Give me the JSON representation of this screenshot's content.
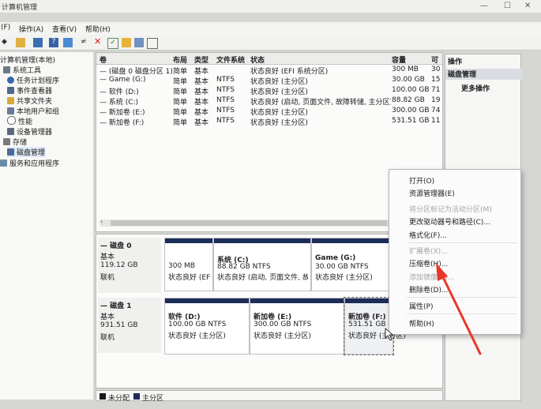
{
  "window": {
    "title": "计算机管理"
  },
  "menu": [
    "(F)",
    "操作(A)",
    "查看(V)",
    "帮助(H)"
  ],
  "tree": [
    {
      "label": "计算机管理(本地)"
    },
    {
      "label": "系统工具"
    },
    {
      "label": "任务计划程序"
    },
    {
      "label": "事件查看器"
    },
    {
      "label": "共享文件夹"
    },
    {
      "label": "本地用户和组"
    },
    {
      "label": "性能"
    },
    {
      "label": "设备管理器"
    },
    {
      "label": "存储"
    },
    {
      "label": "磁盘管理"
    },
    {
      "label": "服务和应用程序"
    }
  ],
  "volume_table": {
    "headers": [
      "卷",
      "布局",
      "类型",
      "文件系统",
      "状态",
      "容量",
      "可"
    ],
    "rows": [
      [
        "— (磁盘 0 磁盘分区 1)",
        "简单",
        "基本",
        "",
        "状态良好 (EFI 系统分区)",
        "300 MB",
        "30"
      ],
      [
        "— Game (G:)",
        "简单",
        "基本",
        "NTFS",
        "状态良好 (主分区)",
        "30.00 GB",
        "15"
      ],
      [
        "— 软件 (D:)",
        "简单",
        "基本",
        "NTFS",
        "状态良好 (主分区)",
        "100.00 GB",
        "71"
      ],
      [
        "— 系统 (C:)",
        "简单",
        "基本",
        "NTFS",
        "状态良好 (启动, 页面文件, 故障转储, 主分区)",
        "88.82 GB",
        "19"
      ],
      [
        "— 新加卷 (E:)",
        "简单",
        "基本",
        "NTFS",
        "状态良好 (主分区)",
        "300.00 GB",
        "74"
      ],
      [
        "— 新加卷 (F:)",
        "简单",
        "基本",
        "NTFS",
        "状态良好 (主分区)",
        "531.51 GB",
        "11"
      ]
    ]
  },
  "disks": [
    {
      "name": "— 磁盘 0",
      "type": "基本",
      "size": "119.12 GB",
      "status": "联机",
      "partitions": [
        {
          "name": "",
          "size": "300 MB",
          "status": "状态良好 (EF"
        },
        {
          "name": "系统 (C:)",
          "size": "88.82 GB NTFS",
          "status": "状态良好 (启动, 页面文件, 故"
        },
        {
          "name": "Game (G:)",
          "size": "30.00 GB NTFS",
          "status": "状态良好 (主分区)"
        }
      ]
    },
    {
      "name": "— 磁盘 1",
      "type": "基本",
      "size": "931.51 GB",
      "status": "联机",
      "partitions": [
        {
          "name": "软件 (D:)",
          "size": "100.00 GB NTFS",
          "status": "状态良好 (主分区)"
        },
        {
          "name": "新加卷 (E:)",
          "size": "300.00 GB NTFS",
          "status": "状态良好 (主分区)"
        },
        {
          "name": "新加卷 (F:)",
          "size": "531.51 GB N",
          "status": "状态良好 (主分区)"
        }
      ]
    }
  ],
  "legend": [
    {
      "label": "未分配",
      "color": "#1a1a1a"
    },
    {
      "label": "主分区",
      "color": "#1d2d5a"
    }
  ],
  "actions": {
    "header": "操作",
    "section": "磁盘管理",
    "more": "更多操作"
  },
  "context_menu": [
    {
      "label": "打开(O)",
      "enabled": true
    },
    {
      "label": "资源管理器(E)",
      "enabled": true
    },
    {
      "label": "将分区标记为活动分区(M)",
      "enabled": false
    },
    {
      "label": "更改驱动器号和路径(C)...",
      "enabled": true
    },
    {
      "label": "格式化(F)...",
      "enabled": true
    },
    {
      "label": "扩展卷(X)...",
      "enabled": false
    },
    {
      "label": "压缩卷(H)...",
      "enabled": true
    },
    {
      "label": "添加镜像(A)...",
      "enabled": false
    },
    {
      "label": "删除卷(D)...",
      "enabled": true
    },
    {
      "label": "属性(P)",
      "enabled": true
    },
    {
      "label": "帮助(H)",
      "enabled": true
    }
  ],
  "colors": {
    "partition_bar": "#1d2d5a",
    "arrow": "#e8372a",
    "selection": "#dfe8f5"
  },
  "icons": [
    "back-icon",
    "folder-icon",
    "help-icon",
    "console-icon",
    "wizard-icon",
    "delete-icon",
    "check-icon",
    "properties-icon",
    "new-folder-icon",
    "view-icon"
  ]
}
